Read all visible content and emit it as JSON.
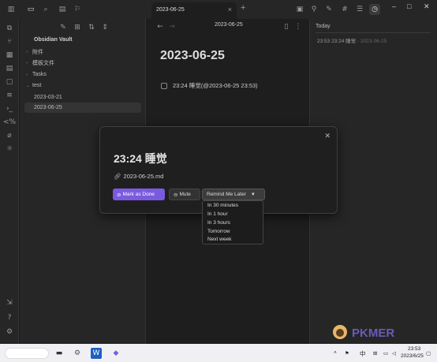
{
  "titlebar": {
    "tab_title": "2023-06-25",
    "tab_close": "×",
    "new_tab": "+",
    "window_controls": [
      "–",
      "□",
      "✕"
    ]
  },
  "sidebar": {
    "vault_name": "Obsidian Vault",
    "items": [
      {
        "label": "附件",
        "type": "folder"
      },
      {
        "label": "模板文件",
        "type": "folder"
      },
      {
        "label": "Tasks",
        "type": "folder"
      },
      {
        "label": "test",
        "type": "folder-open"
      },
      {
        "label": "2023-03-21",
        "type": "file"
      },
      {
        "label": "2023-06-25",
        "type": "file-active"
      }
    ]
  },
  "editor": {
    "header_title": "2023-06-25",
    "doc_title": "2023-06-25",
    "task_text": "23:24 睡觉(@2023-06-25 23:53)"
  },
  "right_panel": {
    "heading": "Today",
    "entry_text": "23:53 23:24 睡觉",
    "entry_date": "- 2023-06-25"
  },
  "modal": {
    "title": "23:24 睡觉",
    "link": "2023-06-25.md",
    "close": "✕",
    "mark_done_label": "Mark as Done",
    "mute_label": "Mute",
    "remind_label": "Remind Me Later"
  },
  "dropdown": {
    "options": [
      "In 30 minutes",
      "In 1 hour",
      "In 3 hours",
      "Tomorrow",
      "Next week"
    ]
  },
  "taskbar": {
    "ime": "中",
    "time": "23:53",
    "date": "2023/6/25"
  },
  "watermark": {
    "brand": "PKMER"
  },
  "colors": {
    "accent": "#7b5ae0",
    "background": "#1e1e1e",
    "sidebar": "#262626"
  }
}
